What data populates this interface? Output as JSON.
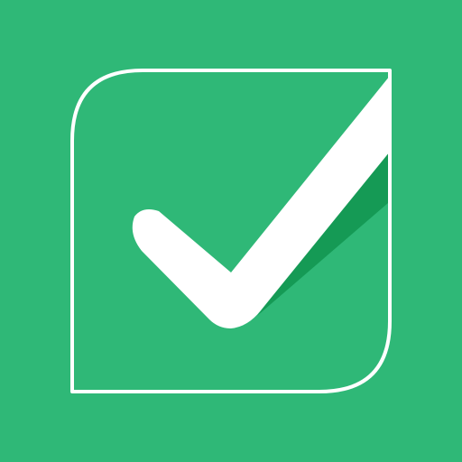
{
  "app_icon": {
    "name": "checkbox-check-icon",
    "colors": {
      "background": "#2fb877",
      "outline": "#ffffff",
      "check": "#ffffff",
      "shadow": "#159a55"
    }
  }
}
